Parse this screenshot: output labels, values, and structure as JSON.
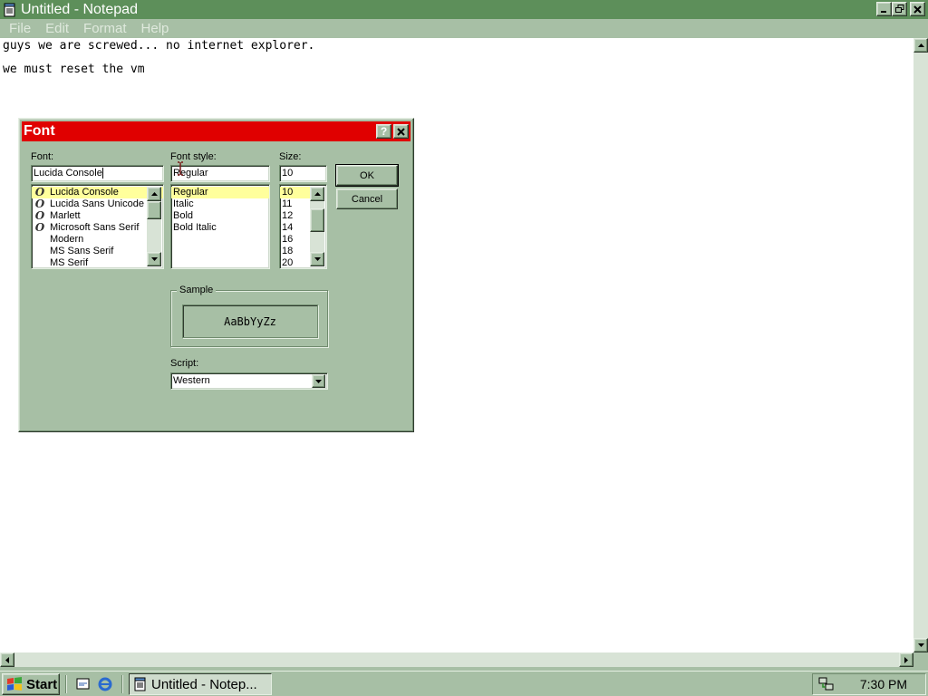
{
  "window": {
    "title": "Untitled - Notepad",
    "menu": [
      "File",
      "Edit",
      "Format",
      "Help"
    ]
  },
  "document": {
    "lines": [
      "guys we are screwed... no internet explorer.",
      "",
      "we must reset the vm"
    ]
  },
  "dialog": {
    "title": "Font",
    "help_glyph": "?",
    "close_glyph": "✕",
    "font_label": "Font:",
    "font_value": "Lucida Console",
    "font_list": [
      {
        "name": "Lucida Console",
        "type": "O",
        "selected": true
      },
      {
        "name": "Lucida Sans Unicode",
        "type": "O",
        "selected": false
      },
      {
        "name": "Marlett",
        "type": "O",
        "selected": false
      },
      {
        "name": "Microsoft Sans Serif",
        "type": "O",
        "selected": false
      },
      {
        "name": "Modern",
        "type": "",
        "selected": false
      },
      {
        "name": "MS Sans Serif",
        "type": "",
        "selected": false
      },
      {
        "name": "MS Serif",
        "type": "",
        "selected": false
      }
    ],
    "style_label": "Font style:",
    "style_value": "Regular",
    "style_list": [
      "Regular",
      "Italic",
      "Bold",
      "Bold Italic"
    ],
    "size_label": "Size:",
    "size_value": "10",
    "size_list": [
      "10",
      "11",
      "12",
      "14",
      "16",
      "18",
      "20"
    ],
    "ok_label": "OK",
    "cancel_label": "Cancel",
    "sample_label": "Sample",
    "sample_text": "AaBbYyZz",
    "script_label": "Script:",
    "script_value": "Western"
  },
  "taskbar": {
    "start_label": "Start",
    "task_label": "Untitled - Notep...",
    "clock": "7:30 PM"
  },
  "icons": {
    "notepad": "notepad-icon",
    "windows_logo": "windows-logo-icon",
    "ie": "internet-explorer-icon",
    "desktop": "show-desktop-icon",
    "tray": "network-tray-icon"
  },
  "colors": {
    "title_active": "#5d8f5a",
    "dialog_title": "#e00000",
    "face": "#a7bfa5",
    "selection": "#ffff9c"
  }
}
